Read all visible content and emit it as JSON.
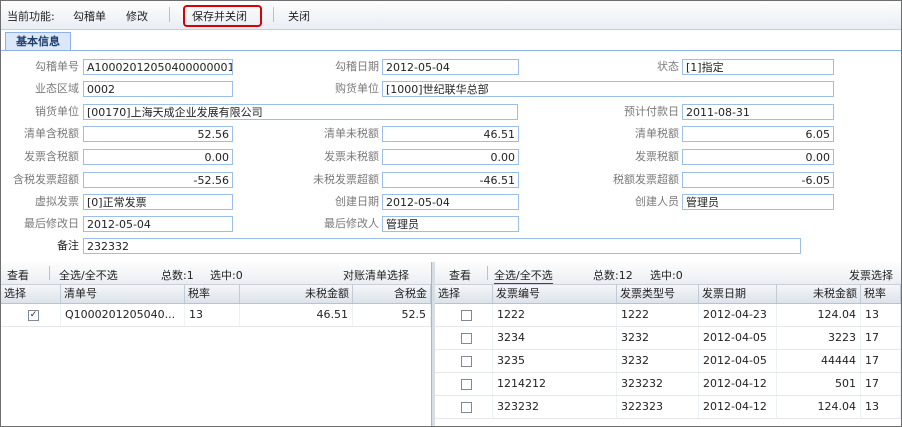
{
  "toolbar": {
    "current_function_label": "当前功能:",
    "mode": "勾稽单",
    "action": "修改",
    "save_close": "保存并关闭",
    "close": "关闭"
  },
  "tab": {
    "label": "基本信息"
  },
  "form": {
    "doc_no_label": "勾稽单号",
    "doc_no": "A10002012050400000001",
    "doc_date_label": "勾稽日期",
    "doc_date": "2012-05-04",
    "status_label": "状态",
    "status": "[1]指定",
    "biz_area_label": "业态区域",
    "biz_area": "0002",
    "buyer_label": "购货单位",
    "buyer": "[1000]世纪联华总部",
    "seller_label": "销货单位",
    "seller": "[00170]上海天成企业发展有限公司",
    "pay_date_label": "预计付款日",
    "pay_date": "2011-08-31",
    "list_tax_incl_label": "清单含税额",
    "list_tax_incl": "52.56",
    "list_tax_excl_label": "清单未税额",
    "list_tax_excl": "46.51",
    "list_tax_label": "清单税额",
    "list_tax": "6.05",
    "inv_tax_incl_label": "发票含税额",
    "inv_tax_incl": "0.00",
    "inv_tax_excl_label": "发票未税额",
    "inv_tax_excl": "0.00",
    "inv_tax_label": "发票税额",
    "inv_tax": "0.00",
    "over_tax_incl_label": "含税发票超额",
    "over_tax_incl": "-52.56",
    "over_tax_excl_label": "未税发票超额",
    "over_tax_excl": "-46.51",
    "over_tax_label": "税额发票超额",
    "over_tax": "-6.05",
    "virtual_inv_label": "虚拟发票",
    "virtual_inv": "[0]正常发票",
    "created_date_label": "创建日期",
    "created_date": "2012-05-04",
    "creator_label": "创建人员",
    "creator": "管理员",
    "modified_date_label": "最后修改日",
    "modified_date": "2012-05-04",
    "modifier_label": "最后修改人",
    "modifier": "管理员",
    "remark_label": "备注",
    "remark": "232332"
  },
  "left_grid": {
    "view": "查看",
    "select_all": "全选/全不选",
    "total": "总数:1",
    "selected": "选中:0",
    "title": "对账清单选择",
    "headers": [
      "选择",
      "清单号",
      "税率",
      "未税金额",
      "含税金"
    ],
    "rows": [
      {
        "checked": "✓",
        "list_no": "Q1000201205040...",
        "rate": "13",
        "amount_excl": "46.51",
        "amount_incl": "52.5"
      }
    ]
  },
  "right_grid": {
    "view": "查看",
    "select_all": "全选/全不选",
    "total": "总数:12",
    "selected": "选中:0",
    "title": "发票选择",
    "headers": [
      "选择",
      "发票编号",
      "发票类型号",
      "发票日期",
      "未税金额",
      "税率"
    ],
    "rows": [
      {
        "no": "1222",
        "type": "1222",
        "date": "2012-04-23",
        "amount": "124.04",
        "rate": "13"
      },
      {
        "no": "3234",
        "type": "3232",
        "date": "2012-04-05",
        "amount": "3223",
        "rate": "17"
      },
      {
        "no": "3235",
        "type": "3232",
        "date": "2012-04-05",
        "amount": "44444",
        "rate": "17"
      },
      {
        "no": "1214212",
        "type": "323232",
        "date": "2012-04-12",
        "amount": "501",
        "rate": "17"
      },
      {
        "no": "323232",
        "type": "322323",
        "date": "2012-04-12",
        "amount": "124.04",
        "rate": "13"
      }
    ]
  },
  "colors": {
    "field_border": "#9cbfe7",
    "highlight": "#d80000",
    "tab_bg": "#dbe8f9"
  }
}
